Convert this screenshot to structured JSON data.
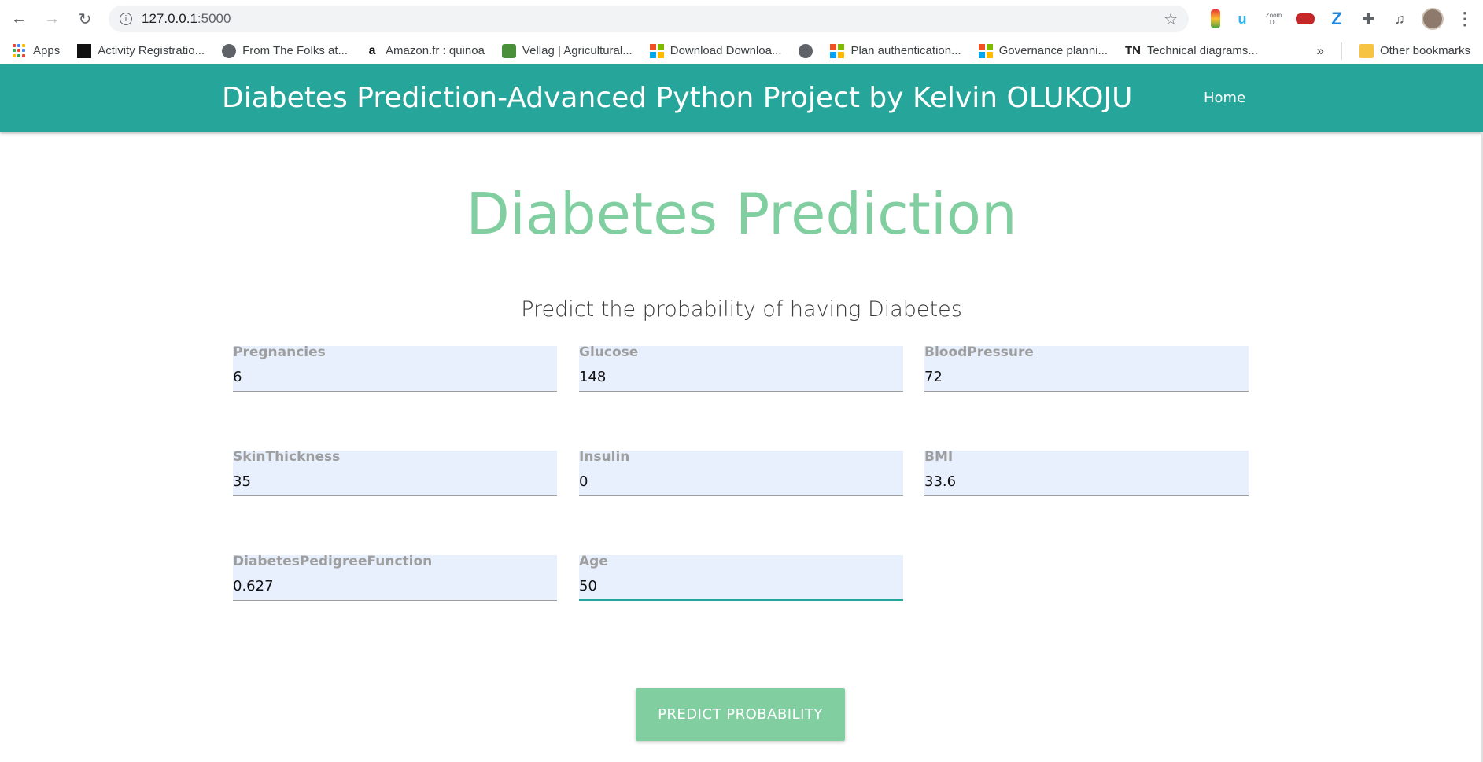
{
  "browser": {
    "url_host": "127.0.0.1",
    "url_port": ":5000",
    "extensions": [
      "download-ext-icon",
      "u-ext-icon",
      "zoom-dl-ext-icon",
      "car-ext-icon",
      "z-ext-icon",
      "puzzle-icon",
      "media-icon"
    ],
    "zoom_ext_label_top": "Zoom",
    "zoom_ext_label_bottom": "DL",
    "z_ext_label": "Z"
  },
  "bookmarks": {
    "items": [
      {
        "label": "Apps"
      },
      {
        "label": "Activity Registratio..."
      },
      {
        "label": "From The Folks at..."
      },
      {
        "label": "Amazon.fr : quinoa"
      },
      {
        "label": "Vellag | Agricultural..."
      },
      {
        "label": "Download Downloa..."
      },
      {
        "label": ""
      },
      {
        "label": "Plan authentication..."
      },
      {
        "label": "Governance planni..."
      },
      {
        "label": "Technical diagrams..."
      }
    ],
    "tn_prefix": "TN",
    "more": "»",
    "other": "Other bookmarks"
  },
  "navbar": {
    "brand": "Diabetes Prediction-Advanced Python Project by Kelvin OLUKOJU",
    "home": "Home"
  },
  "hero": {
    "title": "Diabetes Prediction",
    "subtitle": "Predict the probability of having Diabetes"
  },
  "form": {
    "fields": [
      {
        "label": "Pregnancies",
        "value": "6"
      },
      {
        "label": "Glucose",
        "value": "148"
      },
      {
        "label": "BloodPressure",
        "value": "72"
      },
      {
        "label": "SkinThickness",
        "value": "35"
      },
      {
        "label": "Insulin",
        "value": "0"
      },
      {
        "label": "BMI",
        "value": "33.6"
      },
      {
        "label": "DiabetesPedigreeFunction",
        "value": "0.627"
      },
      {
        "label": "Age",
        "value": "50"
      }
    ],
    "submit": "PREDICT PROBABILITY"
  },
  "colors": {
    "navbar": "#26a69a",
    "accent": "#81cfa0",
    "field_bg": "#e8f0fe"
  }
}
